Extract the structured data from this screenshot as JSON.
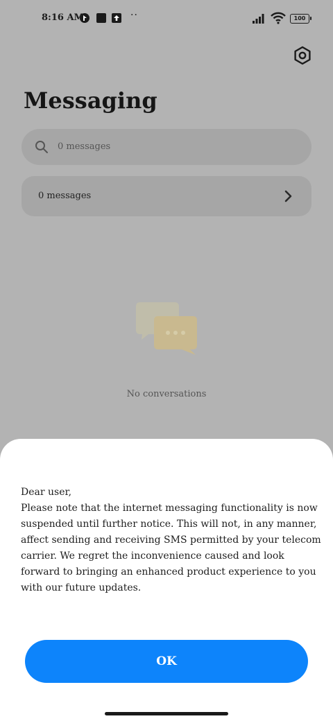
{
  "status_bar": {
    "time": "8:16 AM",
    "battery_level": "100",
    "overflow": "··",
    "icons": [
      "app-notification-icon",
      "stop-square-icon",
      "upload-icon",
      "signal-icon",
      "wifi-icon",
      "battery-icon"
    ]
  },
  "header": {
    "title": "Messaging",
    "settings_icon": "gear-icon"
  },
  "search": {
    "placeholder": "0 messages",
    "icon": "search-icon"
  },
  "messages_row": {
    "label": "0 messages",
    "icon": "chevron-right-icon"
  },
  "empty_state": {
    "icon": "chat-bubbles-icon",
    "text": "No conversations"
  },
  "dialog": {
    "greeting": "Dear user,",
    "body": "Please note that the internet messaging functionality is now suspended until further notice. This will not, in any manner, affect sending and receiving SMS permitted by your telecom carrier. We regret the inconvenience caused and look forward to bringing an enhanced product experience to you with our future updates.",
    "ok_label": "OK"
  },
  "colors": {
    "overlay_background": "#b3b3b3",
    "primary_button": "#0d84fb",
    "sheet_background": "#ffffff"
  }
}
